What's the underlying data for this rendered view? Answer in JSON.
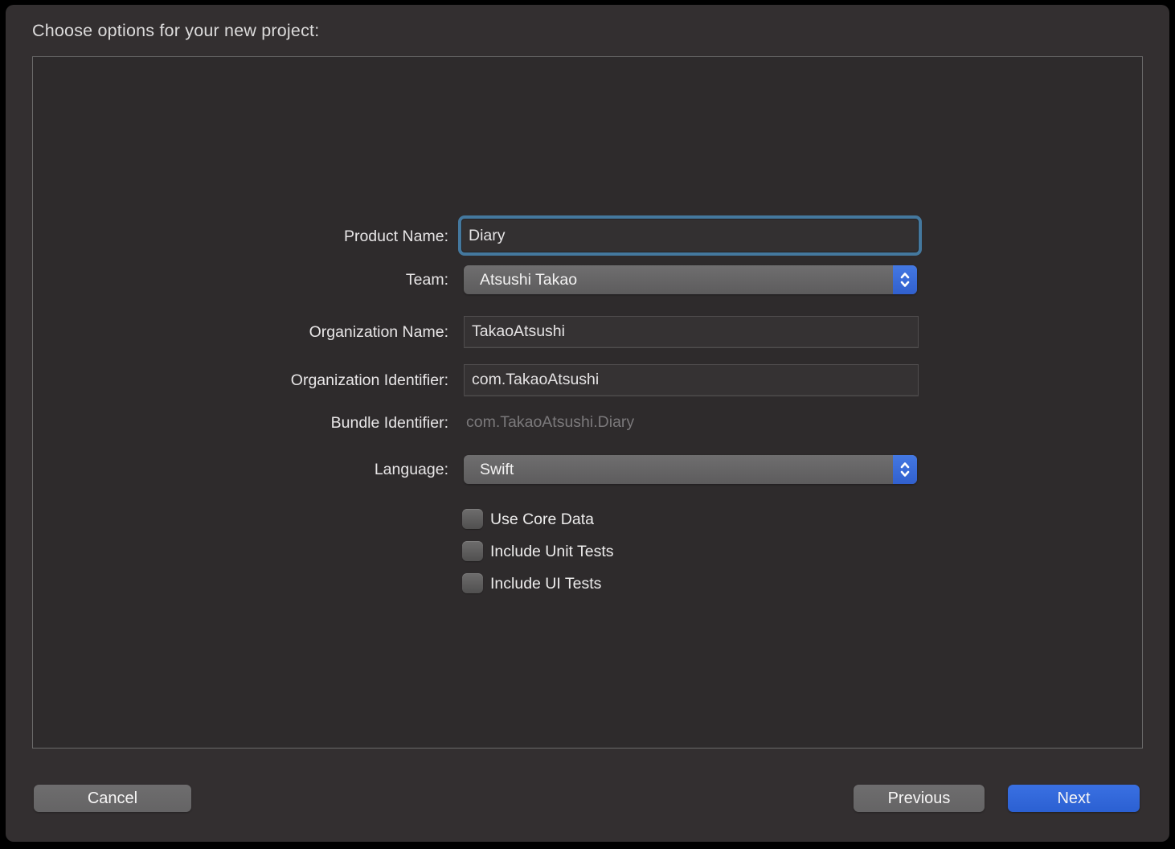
{
  "header": {
    "title": "Choose options for your new project:"
  },
  "form": {
    "product_name": {
      "label": "Product Name:",
      "value": "Diary"
    },
    "team": {
      "label": "Team:",
      "value": "Atsushi Takao"
    },
    "organization_name": {
      "label": "Organization Name:",
      "value": "TakaoAtsushi"
    },
    "organization_identifier": {
      "label": "Organization Identifier:",
      "value": "com.TakaoAtsushi"
    },
    "bundle_identifier": {
      "label": "Bundle Identifier:",
      "value": "com.TakaoAtsushi.Diary"
    },
    "language": {
      "label": "Language:",
      "value": "Swift"
    },
    "checkboxes": [
      {
        "label": "Use Core Data",
        "checked": false
      },
      {
        "label": "Include Unit Tests",
        "checked": false
      },
      {
        "label": "Include UI Tests",
        "checked": false
      }
    ]
  },
  "footer": {
    "cancel_label": "Cancel",
    "previous_label": "Previous",
    "next_label": "Next"
  },
  "colors": {
    "focus_ring_blue": "#44789e",
    "stepper_blue": "#3a6cd9",
    "next_button_blue": "#2f66d8",
    "button_grey": "#6a696a",
    "window_background": "#332f30",
    "content_background": "#2e2b2c",
    "muted_text": "#7b797b"
  }
}
